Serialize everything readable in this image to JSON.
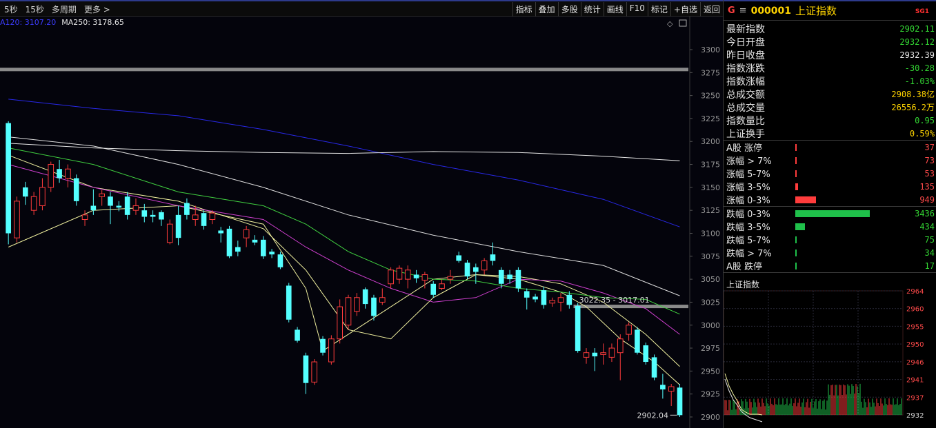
{
  "toolbar": {
    "periods": [
      "5秒",
      "15秒",
      "多周期",
      "更多 >"
    ],
    "tools": [
      "指标",
      "叠加",
      "多股",
      "统计",
      "画线",
      "F10",
      "标记",
      "+自选",
      "返回"
    ]
  },
  "ma_legend": {
    "ma120": "A120: 3107.20",
    "ma250": "MA250: 3178.65"
  },
  "chart_data": {
    "type": "candlestick",
    "y_ticks": [
      3300,
      3275,
      3250,
      3225,
      3200,
      3175,
      3150,
      3125,
      3100,
      3075,
      3050,
      3025,
      3000,
      2975,
      2950,
      2925,
      2900
    ],
    "ylim": [
      2897,
      3309
    ],
    "annotations": {
      "range_label": "3022.35 - 3017.01",
      "last_price_label": "2902.04"
    },
    "candles": [
      {
        "o": 3100,
        "c": 3220,
        "h": 3222,
        "l": 3088,
        "up": false
      },
      {
        "o": 3135,
        "c": 3095,
        "h": 3140,
        "l": 3090,
        "up": true
      },
      {
        "o": 3140,
        "c": 3150,
        "h": 3156,
        "l": 3131,
        "up": false
      },
      {
        "o": 3140,
        "c": 3125,
        "h": 3145,
        "l": 3120,
        "up": true
      },
      {
        "o": 3130,
        "c": 3150,
        "h": 3160,
        "l": 3125,
        "up": true
      },
      {
        "o": 3150,
        "c": 3175,
        "h": 3178,
        "l": 3145,
        "up": true
      },
      {
        "o": 3170,
        "c": 3160,
        "h": 3180,
        "l": 3155,
        "up": false
      },
      {
        "o": 3160,
        "c": 3170,
        "h": 3175,
        "l": 3150,
        "up": true
      },
      {
        "o": 3160,
        "c": 3135,
        "h": 3164,
        "l": 3130,
        "up": false
      },
      {
        "o": 3115,
        "c": 3120,
        "h": 3125,
        "l": 3108,
        "up": true
      },
      {
        "o": 3130,
        "c": 3125,
        "h": 3148,
        "l": 3120,
        "up": false
      },
      {
        "o": 3140,
        "c": 3143,
        "h": 3147,
        "l": 3130,
        "up": true
      },
      {
        "o": 3140,
        "c": 3130,
        "h": 3145,
        "l": 3110,
        "up": false
      },
      {
        "o": 3130,
        "c": 3128,
        "h": 3135,
        "l": 3124,
        "up": false
      },
      {
        "o": 3140,
        "c": 3120,
        "h": 3145,
        "l": 3115,
        "up": false
      },
      {
        "o": 3130,
        "c": 3125,
        "h": 3138,
        "l": 3120,
        "up": true
      },
      {
        "o": 3125,
        "c": 3118,
        "h": 3132,
        "l": 3112,
        "up": false
      },
      {
        "o": 3120,
        "c": 3118,
        "h": 3125,
        "l": 3112,
        "up": false
      },
      {
        "o": 3115,
        "c": 3123,
        "h": 3125,
        "l": 3108,
        "up": false
      },
      {
        "o": 3090,
        "c": 3110,
        "h": 3115,
        "l": 3088,
        "up": true
      },
      {
        "o": 3120,
        "c": 3095,
        "h": 3130,
        "l": 3087,
        "up": false
      },
      {
        "o": 3133,
        "c": 3120,
        "h": 3138,
        "l": 3115,
        "up": false
      },
      {
        "o": 3120,
        "c": 3115,
        "h": 3130,
        "l": 3108,
        "up": true
      },
      {
        "o": 3122,
        "c": 3108,
        "h": 3125,
        "l": 3104,
        "up": false
      },
      {
        "o": 3115,
        "c": 3122,
        "h": 3125,
        "l": 3110,
        "up": true
      },
      {
        "o": 3103,
        "c": 3100,
        "h": 3107,
        "l": 3090,
        "up": false
      },
      {
        "o": 3105,
        "c": 3075,
        "h": 3108,
        "l": 3073,
        "up": false
      },
      {
        "o": 3080,
        "c": 3085,
        "h": 3092,
        "l": 3075,
        "up": false
      },
      {
        "o": 3095,
        "c": 3104,
        "h": 3108,
        "l": 3085,
        "up": true
      },
      {
        "o": 3093,
        "c": 3090,
        "h": 3098,
        "l": 3087,
        "up": false
      },
      {
        "o": 3093,
        "c": 3075,
        "h": 3097,
        "l": 3072,
        "up": false
      },
      {
        "o": 3080,
        "c": 3077,
        "h": 3083,
        "l": 3073,
        "up": false
      },
      {
        "o": 3077,
        "c": 3063,
        "h": 3080,
        "l": 3061,
        "up": false
      },
      {
        "o": 3043,
        "c": 3006,
        "h": 3046,
        "l": 3003,
        "up": false
      },
      {
        "o": 2995,
        "c": 2983,
        "h": 2998,
        "l": 2981,
        "up": false
      },
      {
        "o": 2967,
        "c": 2937,
        "h": 2970,
        "l": 2925,
        "up": false
      },
      {
        "o": 2938,
        "c": 2960,
        "h": 2963,
        "l": 2935,
        "up": true
      },
      {
        "o": 2985,
        "c": 2970,
        "h": 2988,
        "l": 2967,
        "up": false
      },
      {
        "o": 2960,
        "c": 2985,
        "h": 2989,
        "l": 2957,
        "up": true
      },
      {
        "o": 2985,
        "c": 3020,
        "h": 3028,
        "l": 2980,
        "up": true
      },
      {
        "o": 3000,
        "c": 3030,
        "h": 3033,
        "l": 2995,
        "up": true
      },
      {
        "o": 3015,
        "c": 3030,
        "h": 3035,
        "l": 3010,
        "up": true
      },
      {
        "o": 3023,
        "c": 3039,
        "h": 3041,
        "l": 3018,
        "up": false
      },
      {
        "o": 3030,
        "c": 3010,
        "h": 3033,
        "l": 3005,
        "up": false
      },
      {
        "o": 3025,
        "c": 3030,
        "h": 3040,
        "l": 3022,
        "up": true
      },
      {
        "o": 3045,
        "c": 3060,
        "h": 3063,
        "l": 3040,
        "up": true
      },
      {
        "o": 3062,
        "c": 3050,
        "h": 3065,
        "l": 3045,
        "up": true
      },
      {
        "o": 3050,
        "c": 3060,
        "h": 3065,
        "l": 3040,
        "up": true
      },
      {
        "o": 3055,
        "c": 3051,
        "h": 3060,
        "l": 3046,
        "up": false
      },
      {
        "o": 3055,
        "c": 3049,
        "h": 3058,
        "l": 3040,
        "up": true
      },
      {
        "o": 3045,
        "c": 3033,
        "h": 3048,
        "l": 3030,
        "up": false
      },
      {
        "o": 3040,
        "c": 3045,
        "h": 3050,
        "l": 3038,
        "up": true
      },
      {
        "o": 3050,
        "c": 3053,
        "h": 3060,
        "l": 3045,
        "up": true
      },
      {
        "o": 3076,
        "c": 3070,
        "h": 3080,
        "l": 3068,
        "up": false
      },
      {
        "o": 3068,
        "c": 3053,
        "h": 3071,
        "l": 3050,
        "up": false
      },
      {
        "o": 3063,
        "c": 3058,
        "h": 3067,
        "l": 3045,
        "up": false
      },
      {
        "o": 3060,
        "c": 3070,
        "h": 3073,
        "l": 3055,
        "up": true
      },
      {
        "o": 3077,
        "c": 3070,
        "h": 3090,
        "l": 3065,
        "up": false
      },
      {
        "o": 3060,
        "c": 3045,
        "h": 3063,
        "l": 3040,
        "up": false
      },
      {
        "o": 3055,
        "c": 3050,
        "h": 3060,
        "l": 3045,
        "up": false
      },
      {
        "o": 3060,
        "c": 3040,
        "h": 3063,
        "l": 3036,
        "up": false
      },
      {
        "o": 3037,
        "c": 3030,
        "h": 3040,
        "l": 3017,
        "up": false
      },
      {
        "o": 3031,
        "c": 3028,
        "h": 3034,
        "l": 3025,
        "up": false
      },
      {
        "o": 3038,
        "c": 3022,
        "h": 3042,
        "l": 3018,
        "up": false
      },
      {
        "o": 3024,
        "c": 3027,
        "h": 3030,
        "l": 3020,
        "up": true
      },
      {
        "o": 3025,
        "c": 3030,
        "h": 3035,
        "l": 3015,
        "up": true
      },
      {
        "o": 3033,
        "c": 3022,
        "h": 3037,
        "l": 3018,
        "up": false
      },
      {
        "o": 3021,
        "c": 2972,
        "h": 3024,
        "l": 2970,
        "up": false
      },
      {
        "o": 2965,
        "c": 2970,
        "h": 2975,
        "l": 2958,
        "up": true
      },
      {
        "o": 2970,
        "c": 2966,
        "h": 2975,
        "l": 2950,
        "up": false
      },
      {
        "o": 2968,
        "c": 2970,
        "h": 2980,
        "l": 2957,
        "up": true
      },
      {
        "o": 2965,
        "c": 2975,
        "h": 2980,
        "l": 2960,
        "up": true
      },
      {
        "o": 2970,
        "c": 2985,
        "h": 2990,
        "l": 2940,
        "up": true
      },
      {
        "o": 2990,
        "c": 3000,
        "h": 3003,
        "l": 2983,
        "up": true
      },
      {
        "o": 2995,
        "c": 2970,
        "h": 2998,
        "l": 2968,
        "up": false
      },
      {
        "o": 2978,
        "c": 2960,
        "h": 2981,
        "l": 2957,
        "up": false
      },
      {
        "o": 2965,
        "c": 2943,
        "h": 2968,
        "l": 2940,
        "up": false
      },
      {
        "o": 2935,
        "c": 2930,
        "h": 2947,
        "l": 2920,
        "up": false
      },
      {
        "o": 2928,
        "c": 2933,
        "h": 2936,
        "l": 2912,
        "up": true
      },
      {
        "o": 2932,
        "c": 2902,
        "h": 2936,
        "l": 2900,
        "up": false
      }
    ],
    "ma_lines": {
      "ma5": {
        "color": "#f2f2a0",
        "points": [
          [
            0,
            3085
          ],
          [
            10,
            3125
          ],
          [
            20,
            3130
          ],
          [
            30,
            3110
          ],
          [
            35,
            3040
          ],
          [
            37,
            2972
          ],
          [
            40,
            2990
          ],
          [
            45,
            3020
          ],
          [
            50,
            3050
          ],
          [
            55,
            3055
          ],
          [
            60,
            3050
          ],
          [
            65,
            3036
          ],
          [
            68,
            3020
          ],
          [
            72,
            2985
          ],
          [
            76,
            2960
          ],
          [
            79,
            2935
          ]
        ]
      },
      "ma10": {
        "color": "#f2f2a0",
        "points": [
          [
            0,
            3185
          ],
          [
            10,
            3150
          ],
          [
            20,
            3135
          ],
          [
            30,
            3105
          ],
          [
            35,
            3060
          ],
          [
            40,
            2995
          ],
          [
            45,
            2985
          ],
          [
            50,
            3030
          ],
          [
            55,
            3055
          ],
          [
            60,
            3053
          ],
          [
            65,
            3045
          ],
          [
            70,
            3025
          ],
          [
            75,
            2990
          ],
          [
            79,
            2955
          ]
        ]
      },
      "ma20": {
        "color": "#d040d0",
        "points": [
          [
            0,
            3175
          ],
          [
            10,
            3150
          ],
          [
            20,
            3130
          ],
          [
            30,
            3115
          ],
          [
            35,
            3085
          ],
          [
            40,
            3060
          ],
          [
            45,
            3040
          ],
          [
            50,
            3025
          ],
          [
            55,
            3030
          ],
          [
            60,
            3050
          ],
          [
            65,
            3048
          ],
          [
            70,
            3035
          ],
          [
            75,
            3018
          ],
          [
            79,
            2990
          ]
        ]
      },
      "ma30": {
        "color": "#40d040",
        "points": [
          [
            0,
            3193
          ],
          [
            10,
            3175
          ],
          [
            20,
            3145
          ],
          [
            30,
            3130
          ],
          [
            35,
            3110
          ],
          [
            40,
            3080
          ],
          [
            45,
            3060
          ],
          [
            50,
            3050
          ],
          [
            55,
            3048
          ],
          [
            60,
            3040
          ],
          [
            65,
            3036
          ],
          [
            70,
            3030
          ],
          [
            75,
            3028
          ],
          [
            79,
            3012
          ]
        ]
      },
      "ma60": {
        "color": "#e0e0e0",
        "points": [
          [
            0,
            3205
          ],
          [
            10,
            3195
          ],
          [
            20,
            3175
          ],
          [
            30,
            3150
          ],
          [
            40,
            3120
          ],
          [
            50,
            3098
          ],
          [
            60,
            3080
          ],
          [
            70,
            3065
          ],
          [
            79,
            3032
          ]
        ]
      },
      "ma120": {
        "color": "#2828e8",
        "points": [
          [
            0,
            3246
          ],
          [
            10,
            3236
          ],
          [
            20,
            3228
          ],
          [
            30,
            3213
          ],
          [
            40,
            3195
          ],
          [
            50,
            3175
          ],
          [
            60,
            3158
          ],
          [
            70,
            3137
          ],
          [
            79,
            3107
          ]
        ]
      },
      "ma250": {
        "color": "#e8e8e8",
        "points": [
          [
            0,
            3198
          ],
          [
            10,
            3193
          ],
          [
            20,
            3190
          ],
          [
            30,
            3188
          ],
          [
            40,
            3187
          ],
          [
            50,
            3189
          ],
          [
            60,
            3188
          ],
          [
            70,
            3184
          ],
          [
            79,
            3179
          ]
        ]
      }
    },
    "hlines": [
      {
        "y": 3278
      },
      {
        "y": 3020,
        "x_start_index": 67
      }
    ]
  },
  "quote": {
    "g_label": "G",
    "menu_icon": "≡",
    "code": "000001",
    "name": "上证指数",
    "badge": "SG1",
    "rows": [
      {
        "label": "最新指数",
        "value": "2902.11",
        "color": "green"
      },
      {
        "label": "今日开盘",
        "value": "2932.12",
        "color": "green"
      },
      {
        "label": "昨日收盘",
        "value": "2932.39",
        "color": "white"
      },
      {
        "label": "指数涨跌",
        "value": "-30.28",
        "color": "green"
      },
      {
        "label": "指数涨幅",
        "value": "-1.03%",
        "color": "green"
      },
      {
        "label": "总成交额",
        "value": "2908.38亿",
        "color": "yellow"
      },
      {
        "label": "总成交量",
        "value": "26556.2万",
        "color": "yellow"
      },
      {
        "label": "指数量比",
        "value": "0.95",
        "color": "green"
      },
      {
        "label": "上证换手",
        "value": "0.59%",
        "color": "yellow"
      }
    ]
  },
  "breadth_up": [
    {
      "label": "A股 涨停",
      "count": "37",
      "bar": 0.01
    },
    {
      "label": "涨幅 > 7%",
      "count": "73",
      "bar": 0.02
    },
    {
      "label": "涨幅 5-7%",
      "count": "53",
      "bar": 0.01
    },
    {
      "label": "涨幅 3-5%",
      "count": "135",
      "bar": 0.04
    },
    {
      "label": "涨幅 0-3%",
      "count": "949",
      "bar": 0.28
    }
  ],
  "breadth_down": [
    {
      "label": "跌幅 0-3%",
      "count": "3436",
      "bar": 1.0
    },
    {
      "label": "跌幅 3-5%",
      "count": "434",
      "bar": 0.13
    },
    {
      "label": "跌幅 5-7%",
      "count": "75",
      "bar": 0.02
    },
    {
      "label": "跌幅 > 7%",
      "count": "34",
      "bar": 0.01
    },
    {
      "label": "A股 跌停",
      "count": "17",
      "bar": 0.005
    }
  ],
  "mini_chart": {
    "title": "上证指数",
    "y_ticks": [
      "2964",
      "2960",
      "2955",
      "2950",
      "2946",
      "2941",
      "2937",
      "2932"
    ]
  },
  "colors": {
    "up": "#ff3c3c",
    "down": "#54ffff",
    "grid": "#2a2a3a",
    "hline": "#8a8a8a",
    "bar_up": "#ff3c3c",
    "bar_down": "#1fc04a"
  }
}
